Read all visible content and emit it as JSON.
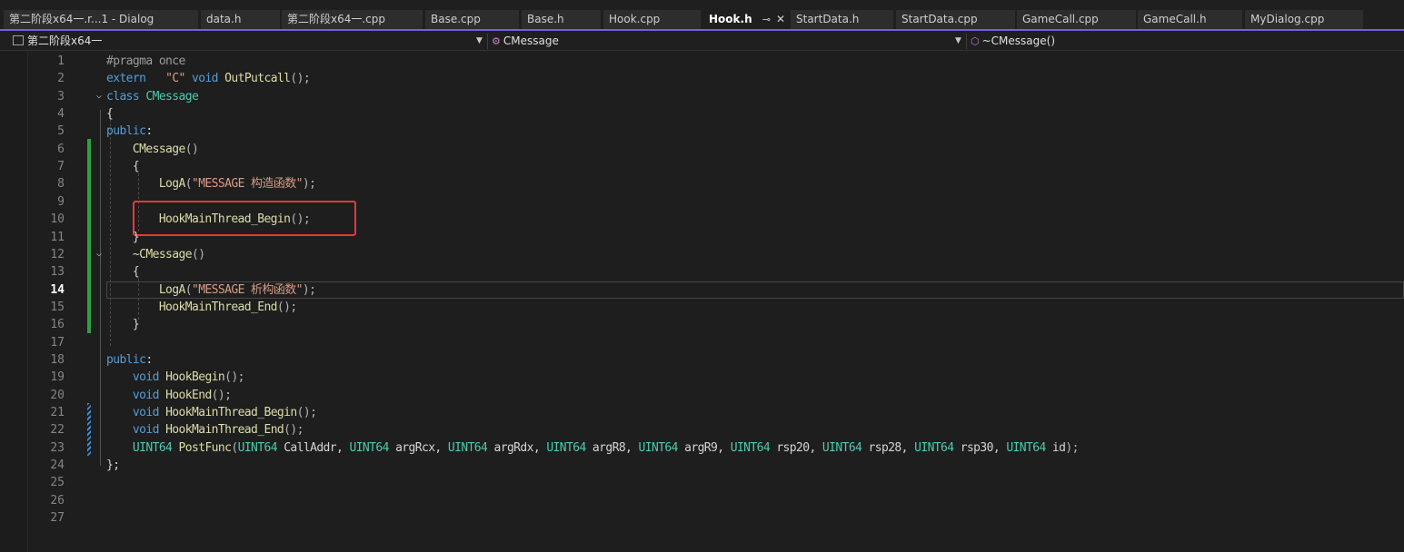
{
  "tabs": [
    {
      "label": "第二阶段x64一.r...1 - Dialog",
      "active": false
    },
    {
      "label": "data.h",
      "active": false
    },
    {
      "label": "第二阶段x64一.cpp",
      "active": false
    },
    {
      "label": "Base.cpp",
      "active": false
    },
    {
      "label": "Base.h",
      "active": false
    },
    {
      "label": "Hook.cpp",
      "active": false
    },
    {
      "label": "Hook.h",
      "active": true
    },
    {
      "label": "StartData.h",
      "active": false
    },
    {
      "label": "StartData.cpp",
      "active": false
    },
    {
      "label": "GameCall.cpp",
      "active": false
    },
    {
      "label": "GameCall.h",
      "active": false
    },
    {
      "label": "MyDialog.cpp",
      "active": false
    }
  ],
  "tab_icons": {
    "pin": "pin-icon",
    "close": "close-icon"
  },
  "nav": {
    "project": "第二阶段x64一",
    "scope": "CMessage",
    "member": "~CMessage()"
  },
  "editor": {
    "current_line": 14,
    "lines": [
      {
        "n": 1,
        "tokens": [
          [
            "pp",
            "#pragma once"
          ]
        ]
      },
      {
        "n": 2,
        "tokens": [
          [
            "kw",
            "extern"
          ],
          [
            "pl",
            "   "
          ],
          [
            "str",
            "\"C\""
          ],
          [
            "pl",
            " "
          ],
          [
            "kw",
            "void"
          ],
          [
            "pl",
            " "
          ],
          [
            "fn",
            "OutPutcall"
          ],
          [
            "par",
            "();"
          ]
        ]
      },
      {
        "n": 3,
        "tokens": [
          [
            "kw",
            "class"
          ],
          [
            "pl",
            " "
          ],
          [
            "ty",
            "CMessage"
          ]
        ]
      },
      {
        "n": 4,
        "tokens": [
          [
            "pl",
            "{"
          ]
        ]
      },
      {
        "n": 5,
        "tokens": [
          [
            "kw",
            "public"
          ],
          [
            "pl",
            ":"
          ]
        ]
      },
      {
        "n": 6,
        "tokens": [
          [
            "pl",
            "    "
          ],
          [
            "fn",
            "CMessage"
          ],
          [
            "par",
            "()"
          ]
        ]
      },
      {
        "n": 7,
        "tokens": [
          [
            "pl",
            "    {"
          ]
        ]
      },
      {
        "n": 8,
        "tokens": [
          [
            "pl",
            "        "
          ],
          [
            "fn",
            "LogA"
          ],
          [
            "par",
            "("
          ],
          [
            "str",
            "\"MESSAGE 构造函数\""
          ],
          [
            "par",
            ");"
          ]
        ]
      },
      {
        "n": 9,
        "tokens": []
      },
      {
        "n": 10,
        "tokens": [
          [
            "pl",
            "        "
          ],
          [
            "fn",
            "HookMainThread_Begin"
          ],
          [
            "par",
            "();"
          ]
        ]
      },
      {
        "n": 11,
        "tokens": [
          [
            "pl",
            "    }"
          ]
        ]
      },
      {
        "n": 12,
        "tokens": [
          [
            "pl",
            "    ~"
          ],
          [
            "fn",
            "CMessage"
          ],
          [
            "par",
            "()"
          ]
        ]
      },
      {
        "n": 13,
        "tokens": [
          [
            "pl",
            "    {"
          ]
        ]
      },
      {
        "n": 14,
        "tokens": [
          [
            "pl",
            "        "
          ],
          [
            "fn",
            "LogA"
          ],
          [
            "par",
            "("
          ],
          [
            "str",
            "\"MESSAGE 析构函数\""
          ],
          [
            "par",
            ");"
          ]
        ]
      },
      {
        "n": 15,
        "tokens": [
          [
            "pl",
            "        "
          ],
          [
            "fn",
            "HookMainThread_End"
          ],
          [
            "par",
            "();"
          ]
        ]
      },
      {
        "n": 16,
        "tokens": [
          [
            "pl",
            "    }"
          ]
        ]
      },
      {
        "n": 17,
        "tokens": []
      },
      {
        "n": 18,
        "tokens": [
          [
            "kw",
            "public"
          ],
          [
            "pl",
            ":"
          ]
        ]
      },
      {
        "n": 19,
        "tokens": [
          [
            "pl",
            "    "
          ],
          [
            "kw",
            "void"
          ],
          [
            "pl",
            " "
          ],
          [
            "fn",
            "HookBegin"
          ],
          [
            "par",
            "();"
          ]
        ]
      },
      {
        "n": 20,
        "tokens": [
          [
            "pl",
            "    "
          ],
          [
            "kw",
            "void"
          ],
          [
            "pl",
            " "
          ],
          [
            "fn",
            "HookEnd"
          ],
          [
            "par",
            "();"
          ]
        ]
      },
      {
        "n": 21,
        "tokens": [
          [
            "pl",
            "    "
          ],
          [
            "kw",
            "void"
          ],
          [
            "pl",
            " "
          ],
          [
            "fn",
            "HookMainThread_Begin"
          ],
          [
            "par",
            "();"
          ]
        ]
      },
      {
        "n": 22,
        "tokens": [
          [
            "pl",
            "    "
          ],
          [
            "kw",
            "void"
          ],
          [
            "pl",
            " "
          ],
          [
            "fn",
            "HookMainThread_End"
          ],
          [
            "par",
            "();"
          ]
        ]
      },
      {
        "n": 23,
        "tokens": [
          [
            "pl",
            "    "
          ],
          [
            "ty",
            "UINT64"
          ],
          [
            "pl",
            " "
          ],
          [
            "fn",
            "PostFunc"
          ],
          [
            "par",
            "("
          ],
          [
            "ty",
            "UINT64"
          ],
          [
            "pl",
            " CallAddr, "
          ],
          [
            "ty",
            "UINT64"
          ],
          [
            "pl",
            " argRcx, "
          ],
          [
            "ty",
            "UINT64"
          ],
          [
            "pl",
            " argRdx, "
          ],
          [
            "ty",
            "UINT64"
          ],
          [
            "pl",
            " argR8, "
          ],
          [
            "ty",
            "UINT64"
          ],
          [
            "pl",
            " argR9, "
          ],
          [
            "ty",
            "UINT64"
          ],
          [
            "pl",
            " rsp20, "
          ],
          [
            "ty",
            "UINT64"
          ],
          [
            "pl",
            " rsp28, "
          ],
          [
            "ty",
            "UINT64"
          ],
          [
            "pl",
            " rsp30, "
          ],
          [
            "ty",
            "UINT64"
          ],
          [
            "pl",
            " id"
          ],
          [
            "par",
            ");"
          ]
        ]
      },
      {
        "n": 24,
        "tokens": [
          [
            "pl",
            "};"
          ]
        ]
      },
      {
        "n": 25,
        "tokens": []
      },
      {
        "n": 26,
        "tokens": []
      },
      {
        "n": 27,
        "tokens": []
      }
    ]
  },
  "fold_icons": {
    "icon": "chevron-down-icon"
  },
  "colors": {
    "accent": "#7160e8",
    "keyword": "#569cd6",
    "string": "#d69d85",
    "function": "#dcdcaa",
    "type": "#4ec9b0",
    "change_saved": "#2ea043",
    "change_unsaved": "#3c8bdc",
    "annotation_box": "#e23b3b"
  }
}
